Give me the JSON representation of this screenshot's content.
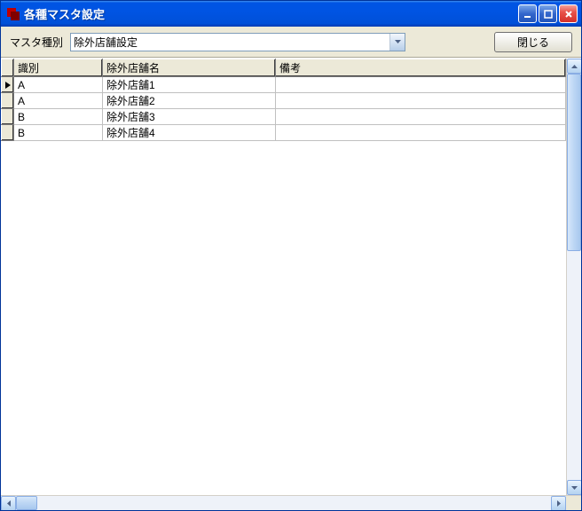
{
  "window": {
    "title": "各種マスタ設定"
  },
  "toolbar": {
    "type_label": "マスタ種別",
    "combo_value": "除外店舗設定",
    "close_label": "閉じる"
  },
  "grid": {
    "headers": {
      "id": "識別",
      "name": "除外店舗名",
      "remarks": "備考"
    },
    "rows": [
      {
        "id": "A",
        "name": "除外店舗1",
        "remarks": ""
      },
      {
        "id": "A",
        "name": "除外店舗2",
        "remarks": ""
      },
      {
        "id": "B",
        "name": "除外店舗3",
        "remarks": ""
      },
      {
        "id": "B",
        "name": "除外店舗4",
        "remarks": ""
      }
    ]
  }
}
